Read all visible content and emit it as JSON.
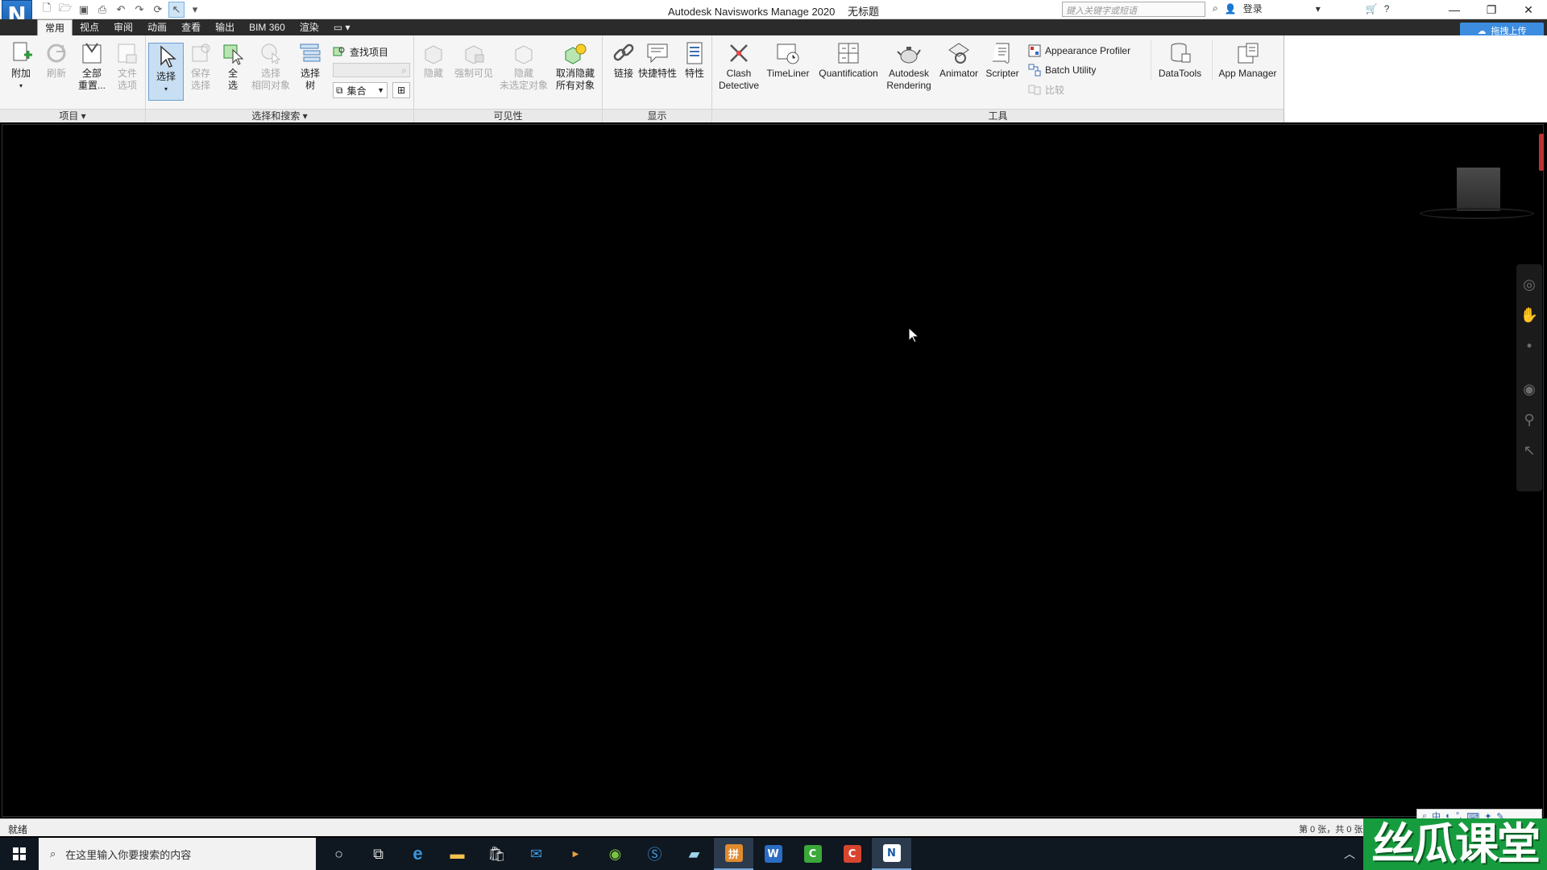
{
  "titlebar": {
    "app_logo": "N",
    "app_name": "Autodesk Navisworks Manage 2020",
    "document": "无标题",
    "search_placeholder": "键入关键字或短语",
    "login": "登录"
  },
  "tabs": [
    "常用",
    "视点",
    "审阅",
    "动画",
    "查看",
    "输出",
    "BIM 360",
    "渲染"
  ],
  "cloud_upload": "拖拽上传",
  "ribbon": {
    "project": {
      "label": "项目",
      "append": "附加",
      "refresh": "刷新",
      "reset_all_1": "全部",
      "reset_all_2": "重置...",
      "file_options_1": "文件",
      "file_options_2": "选项"
    },
    "select": {
      "label": "选择和搜索",
      "select": "选择",
      "save_sel_1": "保存",
      "save_sel_2": "选择",
      "select_all_1": "全",
      "select_all_2": "选",
      "select_same_1": "选择",
      "select_same_2": "相同对象",
      "sel_tree_1": "选择",
      "sel_tree_2": "树",
      "find_items": "查找项目",
      "sets": "集合"
    },
    "visibility": {
      "label": "可见性",
      "hide": "隐藏",
      "require": "强制可见",
      "hide_unsel_1": "隐藏",
      "hide_unsel_2": "未选定对象",
      "unhide_1": "取消隐藏",
      "unhide_2": "所有对象"
    },
    "display": {
      "label": "显示",
      "links": "链接",
      "quick_props": "快捷特性",
      "props": "特性"
    },
    "tools": {
      "label": "工具",
      "clash_1": "Clash",
      "clash_2": "Detective",
      "timeliner": "TimeLiner",
      "quantification": "Quantification",
      "rendering_1": "Autodesk",
      "rendering_2": "Rendering",
      "animator": "Animator",
      "scripter": "Scripter",
      "appearance_profiler": "Appearance Profiler",
      "batch_utility": "Batch Utility",
      "compare": "比较",
      "datatools": "DataTools",
      "app_manager": "App Manager"
    }
  },
  "statusbar": {
    "status": "就绪",
    "sheet_info": "第 0 张，共 0 张"
  },
  "ime": [
    "中",
    "◐",
    "°,",
    "⌨",
    "✦",
    "✎"
  ],
  "taskbar": {
    "search_placeholder": "在这里输入你要搜索的内容",
    "tiles": [
      "e",
      "W",
      "C",
      "C",
      "N"
    ]
  },
  "watermark": "丝瓜课堂",
  "colors": {
    "accent": "#3c8de0",
    "tab_bar": "#2b2b2b",
    "ribbon": "#f5f5f5",
    "viewport": "#000000",
    "watermark": "#169c3e"
  }
}
